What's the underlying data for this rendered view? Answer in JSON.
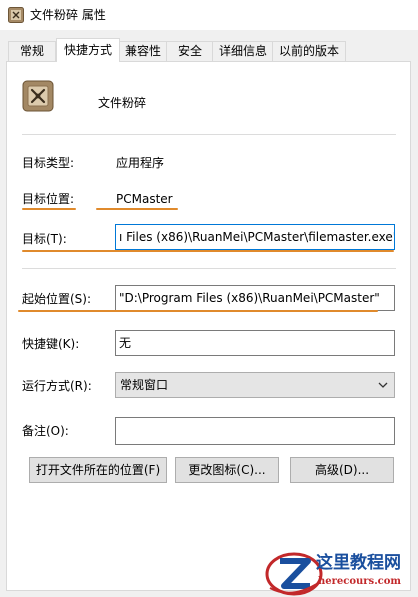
{
  "window": {
    "title": "文件粉碎 属性"
  },
  "tabs": [
    {
      "label": "常规"
    },
    {
      "label": "快捷方式"
    },
    {
      "label": "兼容性"
    },
    {
      "label": "安全"
    },
    {
      "label": "详细信息"
    },
    {
      "label": "以前的版本"
    }
  ],
  "active_tab": "快捷方式",
  "shortcut": {
    "name": "文件粉碎"
  },
  "fields": {
    "target_type_label": "目标类型:",
    "target_type_value": "应用程序",
    "target_location_label": "目标位置:",
    "target_location_value": "PCMaster",
    "target_label": "目标(T):",
    "target_value": "ı Files (x86)\\RuanMei\\PCMaster\\filemaster.exe\"",
    "start_in_label": "起始位置(S):",
    "start_in_value": "\"D:\\Program Files (x86)\\RuanMei\\PCMaster\"",
    "hotkey_label": "快捷键(K):",
    "hotkey_value": "无",
    "run_label": "运行方式(R):",
    "run_value": "常规窗口",
    "comment_label": "备注(O):",
    "comment_value": ""
  },
  "buttons": {
    "open_location": "打开文件所在的位置(F)",
    "change_icon": "更改图标(C)...",
    "advanced": "高级(D)..."
  },
  "watermark": {
    "line1": "这里教程网",
    "line2": "herecours.com"
  },
  "colors": {
    "highlight_underline": "#e08a2c",
    "watermark_blue": "#1a4f9e",
    "watermark_red": "#c2282a"
  }
}
